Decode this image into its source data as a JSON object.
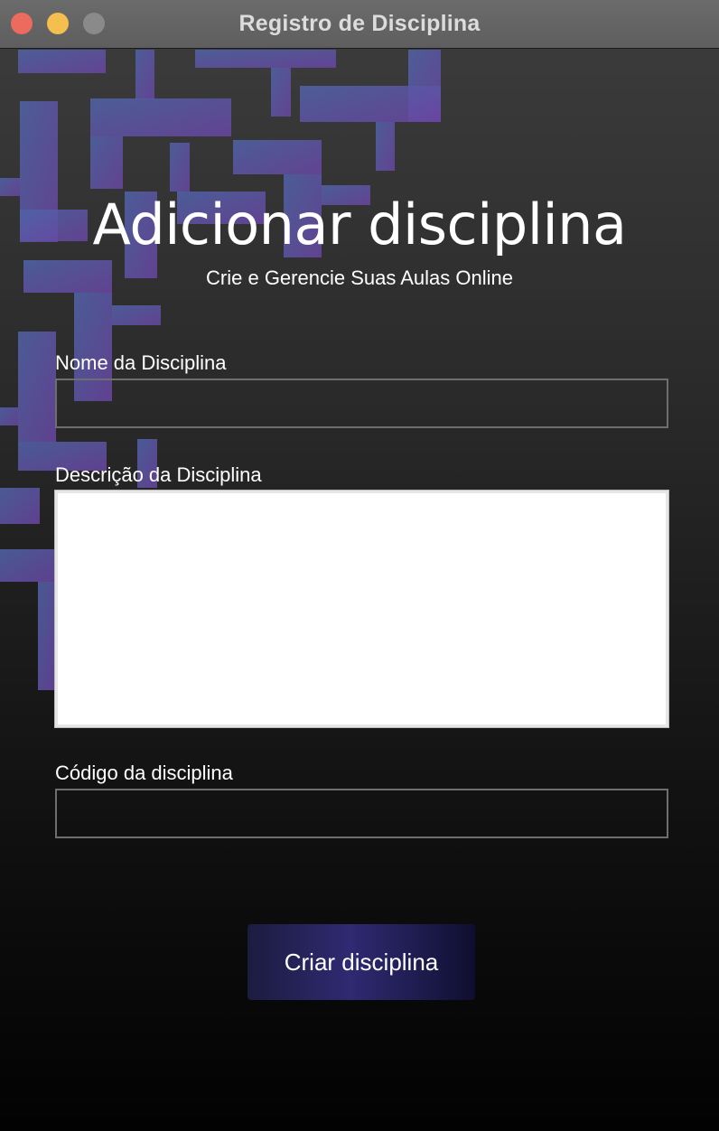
{
  "window": {
    "title": "Registro de Disciplina"
  },
  "header": {
    "title": "Adicionar disciplina",
    "subtitle": "Crie e Gerencie Suas Aulas Online"
  },
  "form": {
    "name_label": "Nome da Disciplina",
    "name_value": "",
    "description_label": "Descrição da Disciplina",
    "description_value": "",
    "code_label": "Código da disciplina",
    "code_value": "",
    "submit_label": "Criar disciplina"
  },
  "colors": {
    "accent": "#2f2a72",
    "tile_start": "#4a5fa6",
    "tile_end": "#6a47a0",
    "close": "#ec6a5e",
    "minimize": "#f4bf4f",
    "maximize": "#8a8a8a"
  }
}
